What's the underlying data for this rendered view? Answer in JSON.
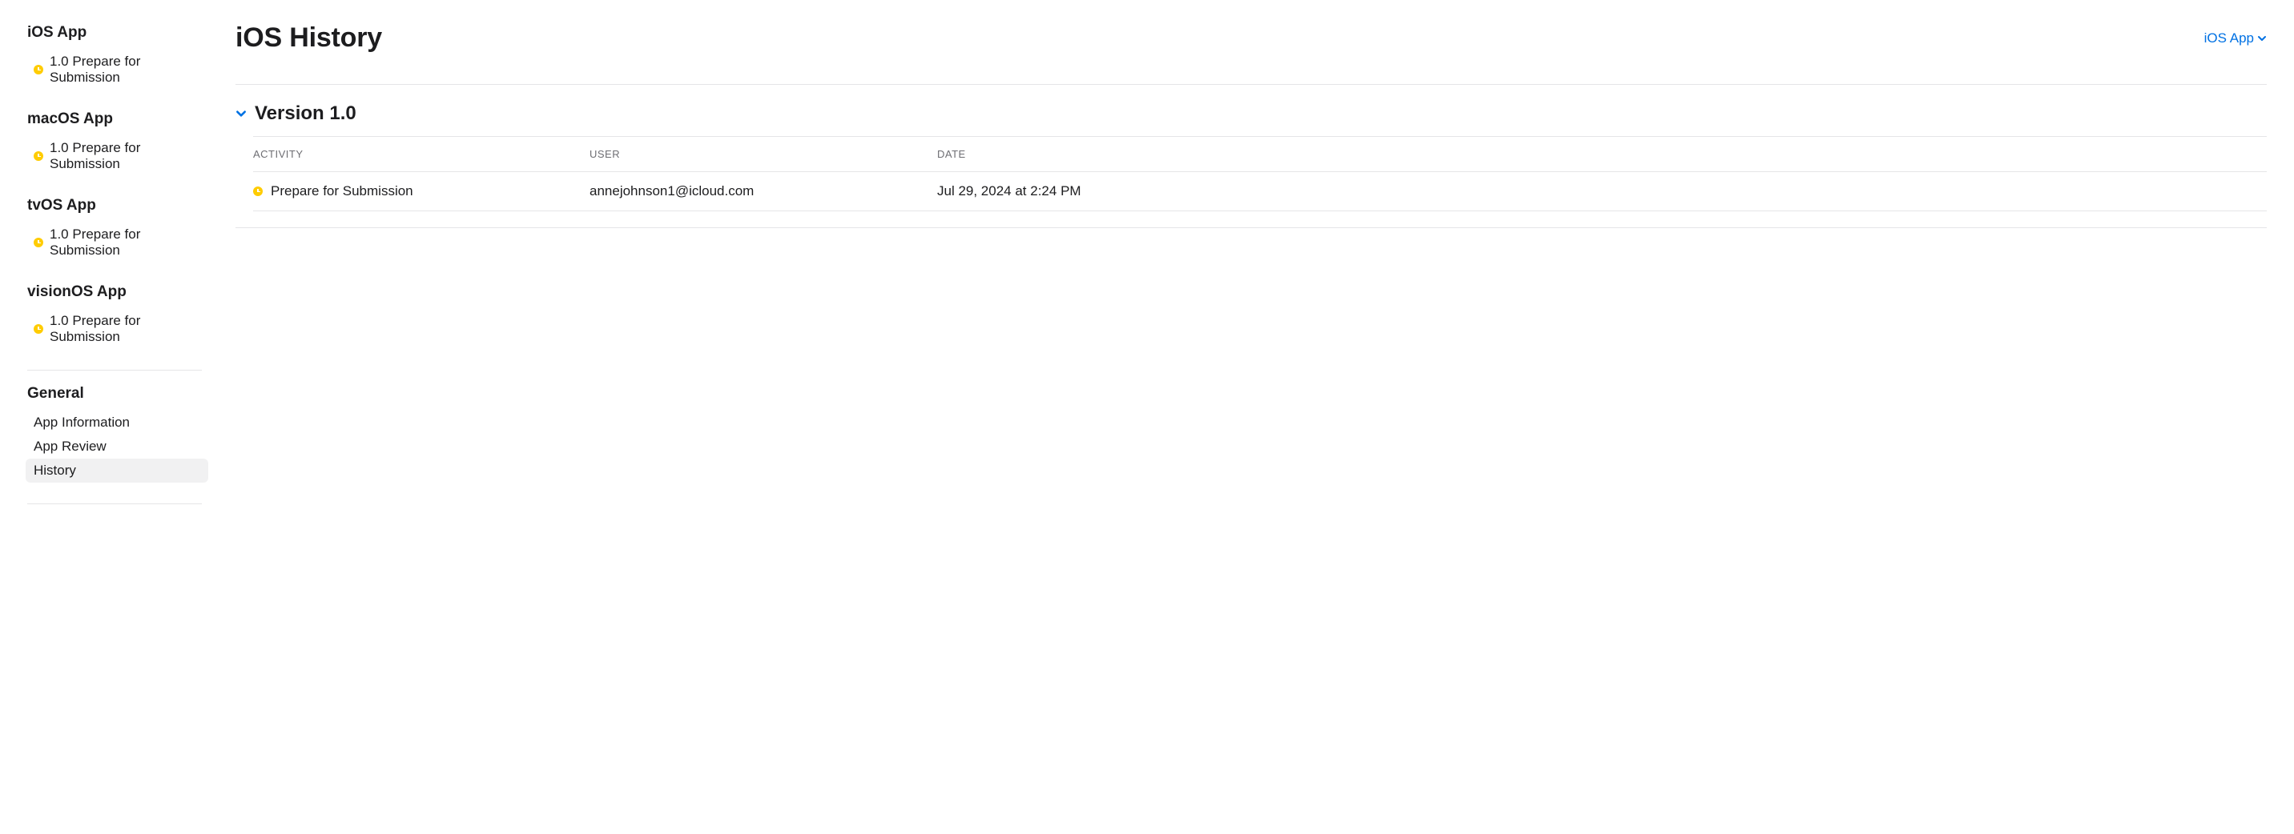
{
  "sidebar": {
    "platforms": [
      {
        "heading": "iOS App",
        "status_label": "1.0 Prepare for Submission"
      },
      {
        "heading": "macOS App",
        "status_label": "1.0 Prepare for Submission"
      },
      {
        "heading": "tvOS App",
        "status_label": "1.0 Prepare for Submission"
      },
      {
        "heading": "visionOS App",
        "status_label": "1.0 Prepare for Submission"
      }
    ],
    "general": {
      "heading": "General",
      "items": [
        {
          "label": "App Information",
          "selected": false
        },
        {
          "label": "App Review",
          "selected": false
        },
        {
          "label": "History",
          "selected": true
        }
      ]
    }
  },
  "main": {
    "title": "iOS History",
    "platform_picker": "iOS App",
    "version_section": {
      "title": "Version 1.0",
      "columns": {
        "activity": "ACTIVITY",
        "user": "USER",
        "date": "DATE"
      },
      "rows": [
        {
          "activity": "Prepare for Submission",
          "user": "annejohnson1@icloud.com",
          "date": "Jul 29, 2024 at 2:24 PM"
        }
      ]
    }
  }
}
